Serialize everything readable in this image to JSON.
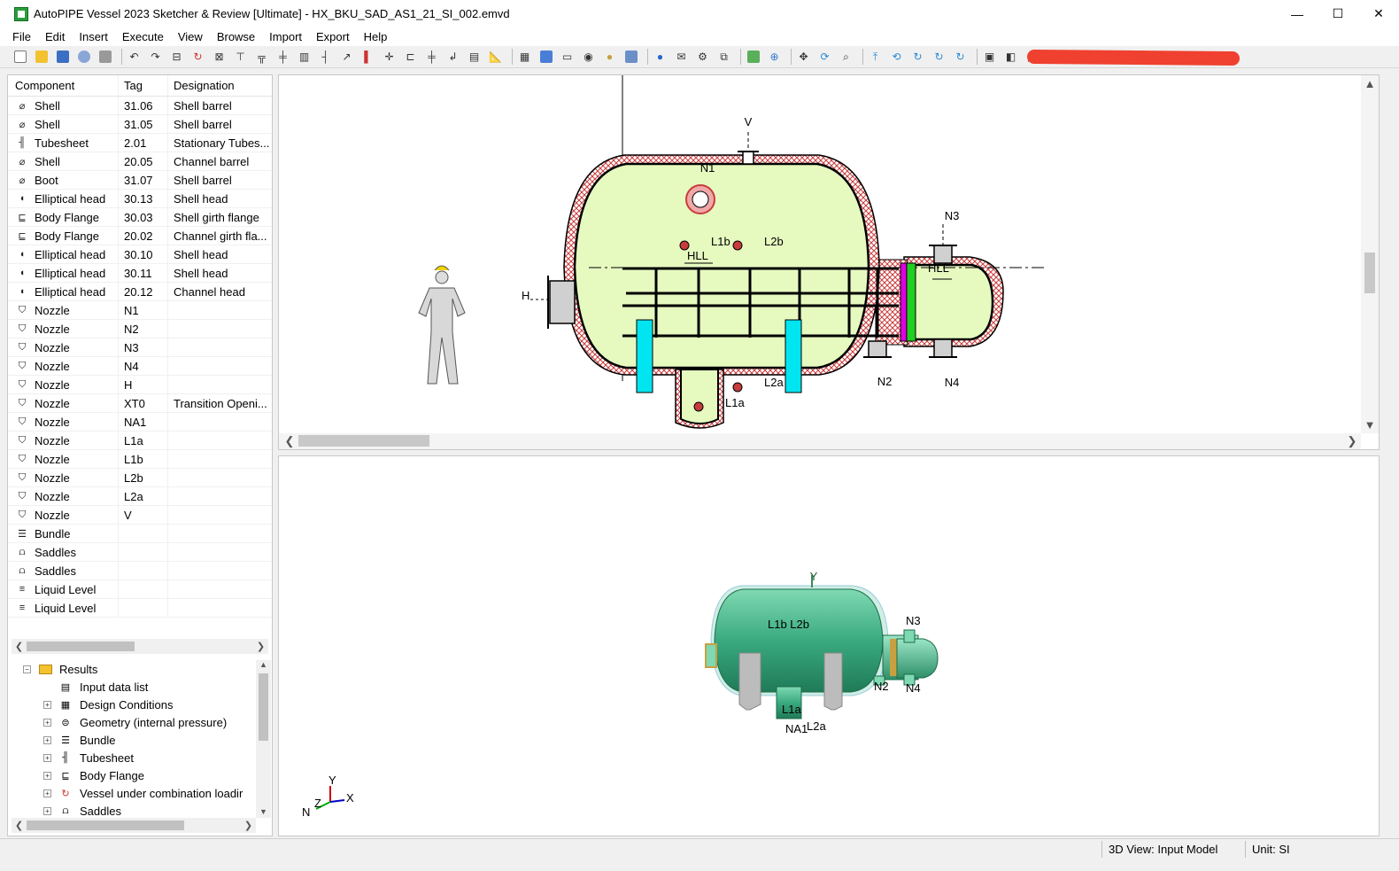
{
  "window": {
    "title": "AutoPIPE Vessel 2023 Sketcher & Review [Ultimate] - HX_BKU_SAD_AS1_21_SI_002.emvd",
    "minimize": "—",
    "maximize": "☐",
    "close": "✕"
  },
  "menu": [
    "File",
    "Edit",
    "Insert",
    "Execute",
    "View",
    "Browse",
    "Import",
    "Export",
    "Help"
  ],
  "component_table": {
    "headers": [
      "Component",
      "Tag",
      "Designation"
    ],
    "rows": [
      {
        "icon": "shell-icon",
        "component": "Shell",
        "tag": "31.06",
        "designation": "Shell barrel"
      },
      {
        "icon": "shell-icon",
        "component": "Shell",
        "tag": "31.05",
        "designation": "Shell barrel"
      },
      {
        "icon": "tubesheet-icon",
        "component": "Tubesheet",
        "tag": "2.01",
        "designation": "Stationary Tubes..."
      },
      {
        "icon": "shell-icon",
        "component": "Shell",
        "tag": "20.05",
        "designation": "Channel barrel"
      },
      {
        "icon": "shell-icon",
        "component": "Boot",
        "tag": "31.07",
        "designation": "Shell barrel"
      },
      {
        "icon": "head-icon",
        "component": "Elliptical head",
        "tag": "30.13",
        "designation": "Shell head"
      },
      {
        "icon": "flange-icon",
        "component": "Body Flange",
        "tag": "30.03",
        "designation": "Shell girth flange"
      },
      {
        "icon": "flange-icon",
        "component": "Body Flange",
        "tag": "20.02",
        "designation": "Channel girth fla..."
      },
      {
        "icon": "head-icon",
        "component": "Elliptical head",
        "tag": "30.10",
        "designation": "Shell head"
      },
      {
        "icon": "head-icon",
        "component": "Elliptical head",
        "tag": "30.11",
        "designation": "Shell head"
      },
      {
        "icon": "head-icon",
        "component": "Elliptical head",
        "tag": "20.12",
        "designation": "Channel head"
      },
      {
        "icon": "nozzle-icon",
        "component": "Nozzle",
        "tag": "N1",
        "designation": ""
      },
      {
        "icon": "nozzle-icon",
        "component": "Nozzle",
        "tag": "N2",
        "designation": ""
      },
      {
        "icon": "nozzle-icon",
        "component": "Nozzle",
        "tag": "N3",
        "designation": ""
      },
      {
        "icon": "nozzle-icon",
        "component": "Nozzle",
        "tag": "N4",
        "designation": ""
      },
      {
        "icon": "nozzle-icon",
        "component": "Nozzle",
        "tag": "H",
        "designation": ""
      },
      {
        "icon": "nozzle-icon",
        "component": "Nozzle",
        "tag": "XT0",
        "designation": "Transition Openi..."
      },
      {
        "icon": "nozzle-icon",
        "component": "Nozzle",
        "tag": "NA1",
        "designation": ""
      },
      {
        "icon": "nozzle-icon",
        "component": "Nozzle",
        "tag": "L1a",
        "designation": ""
      },
      {
        "icon": "nozzle-icon",
        "component": "Nozzle",
        "tag": "L1b",
        "designation": ""
      },
      {
        "icon": "nozzle-icon",
        "component": "Nozzle",
        "tag": "L2b",
        "designation": ""
      },
      {
        "icon": "nozzle-icon",
        "component": "Nozzle",
        "tag": "L2a",
        "designation": ""
      },
      {
        "icon": "nozzle-icon",
        "component": "Nozzle",
        "tag": "V",
        "designation": ""
      },
      {
        "icon": "bundle-icon",
        "component": "Bundle",
        "tag": "",
        "designation": ""
      },
      {
        "icon": "saddle-icon",
        "component": "Saddles",
        "tag": "",
        "designation": ""
      },
      {
        "icon": "saddle-icon",
        "component": "Saddles",
        "tag": "",
        "designation": ""
      },
      {
        "icon": "liquid-level-icon",
        "component": "Liquid Level",
        "tag": "",
        "designation": ""
      },
      {
        "icon": "liquid-level-icon",
        "component": "Liquid Level",
        "tag": "",
        "designation": ""
      }
    ]
  },
  "tree": {
    "root": "Results",
    "items": [
      {
        "label": "Input data list",
        "icon": "document-icon",
        "expandable": false
      },
      {
        "label": "Design Conditions",
        "icon": "conditions-icon",
        "expandable": true
      },
      {
        "label": "Geometry (internal pressure)",
        "icon": "geometry-icon",
        "expandable": true
      },
      {
        "label": "Bundle",
        "icon": "bundle-icon",
        "expandable": true
      },
      {
        "label": "Tubesheet",
        "icon": "tubesheet-icon",
        "expandable": true
      },
      {
        "label": "Body Flange",
        "icon": "flange-icon",
        "expandable": true
      },
      {
        "label": "Vessel under combination loadir",
        "icon": "load-combination-icon",
        "expandable": true
      },
      {
        "label": "Saddles",
        "icon": "saddle-icon",
        "expandable": true
      }
    ]
  },
  "sketch_labels": {
    "V": "V",
    "N1": "N1",
    "N3": "N3",
    "L1b": "L1b",
    "L2b": "L2b",
    "HLL_left": "HLL",
    "HLL_right": "HLL",
    "H": "H",
    "N2": "N2",
    "N4": "N4",
    "L2a": "L2a",
    "L1a": "L1a"
  },
  "model3d_labels": {
    "Y": "Y",
    "L1b_L2b": "L1b  L2b",
    "N3": "N3",
    "N2": "N2",
    "N4": "N4",
    "L1a": "L1a",
    "NA1": "NA1",
    "L2a": "L2a"
  },
  "triad": {
    "y": "Y",
    "z": "Z",
    "x": "X",
    "n": "N"
  },
  "colors": {
    "shell_fill": "#e6fac0",
    "hatch": "#c83c3c",
    "saddle": "#00e5f0",
    "tubesheet_magenta": "#e000e0",
    "tubesheet_green": "#20d020",
    "model3d": "#3aaa80"
  },
  "status": {
    "view": "3D View: Input Model",
    "unit": "Unit: SI"
  }
}
